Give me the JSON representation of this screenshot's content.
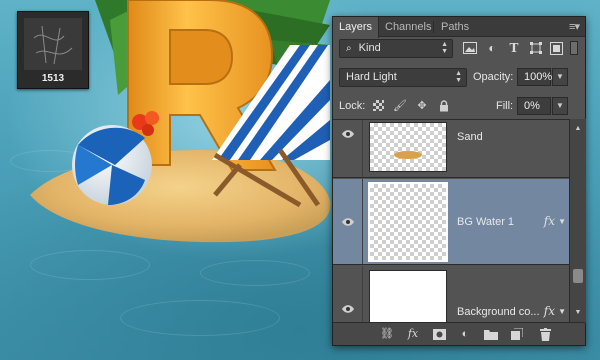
{
  "thumbnail": {
    "label": "1513"
  },
  "panel": {
    "tabs": [
      {
        "label": "Layers",
        "active": true
      },
      {
        "label": "Channels",
        "active": false
      },
      {
        "label": "Paths",
        "active": false
      }
    ],
    "menu_icon": "panel-menu-icon",
    "filter": {
      "kind_label": "Kind",
      "icons": [
        "pixel-filter-icon",
        "adjustment-filter-icon",
        "type-filter-icon",
        "shape-filter-icon",
        "smart-object-filter-icon",
        "filter-toggle-icon"
      ]
    },
    "blend": {
      "mode": "Hard Light",
      "opacity_label": "Opacity:",
      "opacity_value": "100%"
    },
    "lock": {
      "label": "Lock:",
      "icons": [
        "lock-transparent-icon",
        "lock-image-icon",
        "lock-position-icon",
        "lock-all-icon"
      ],
      "fill_label": "Fill:",
      "fill_value": "0%"
    },
    "layers": [
      {
        "name": "Sand",
        "visible": true,
        "selected": false,
        "thumb": "checker-sand",
        "fx": false
      },
      {
        "name": "BG Water 1",
        "visible": true,
        "selected": true,
        "thumb": "checker",
        "fx": true
      },
      {
        "name": "Background co...",
        "visible": true,
        "selected": false,
        "thumb": "white",
        "fx": true
      }
    ],
    "fx_label": "fx",
    "footer_icons": [
      "link-layers-icon",
      "fx-icon",
      "add-mask-icon",
      "adjustment-layer-icon",
      "new-group-icon",
      "new-layer-icon",
      "delete-icon"
    ]
  },
  "colors": {
    "panel_bg": "#535353",
    "selected_row": "#7387a1",
    "water": "#4aa0b8"
  }
}
